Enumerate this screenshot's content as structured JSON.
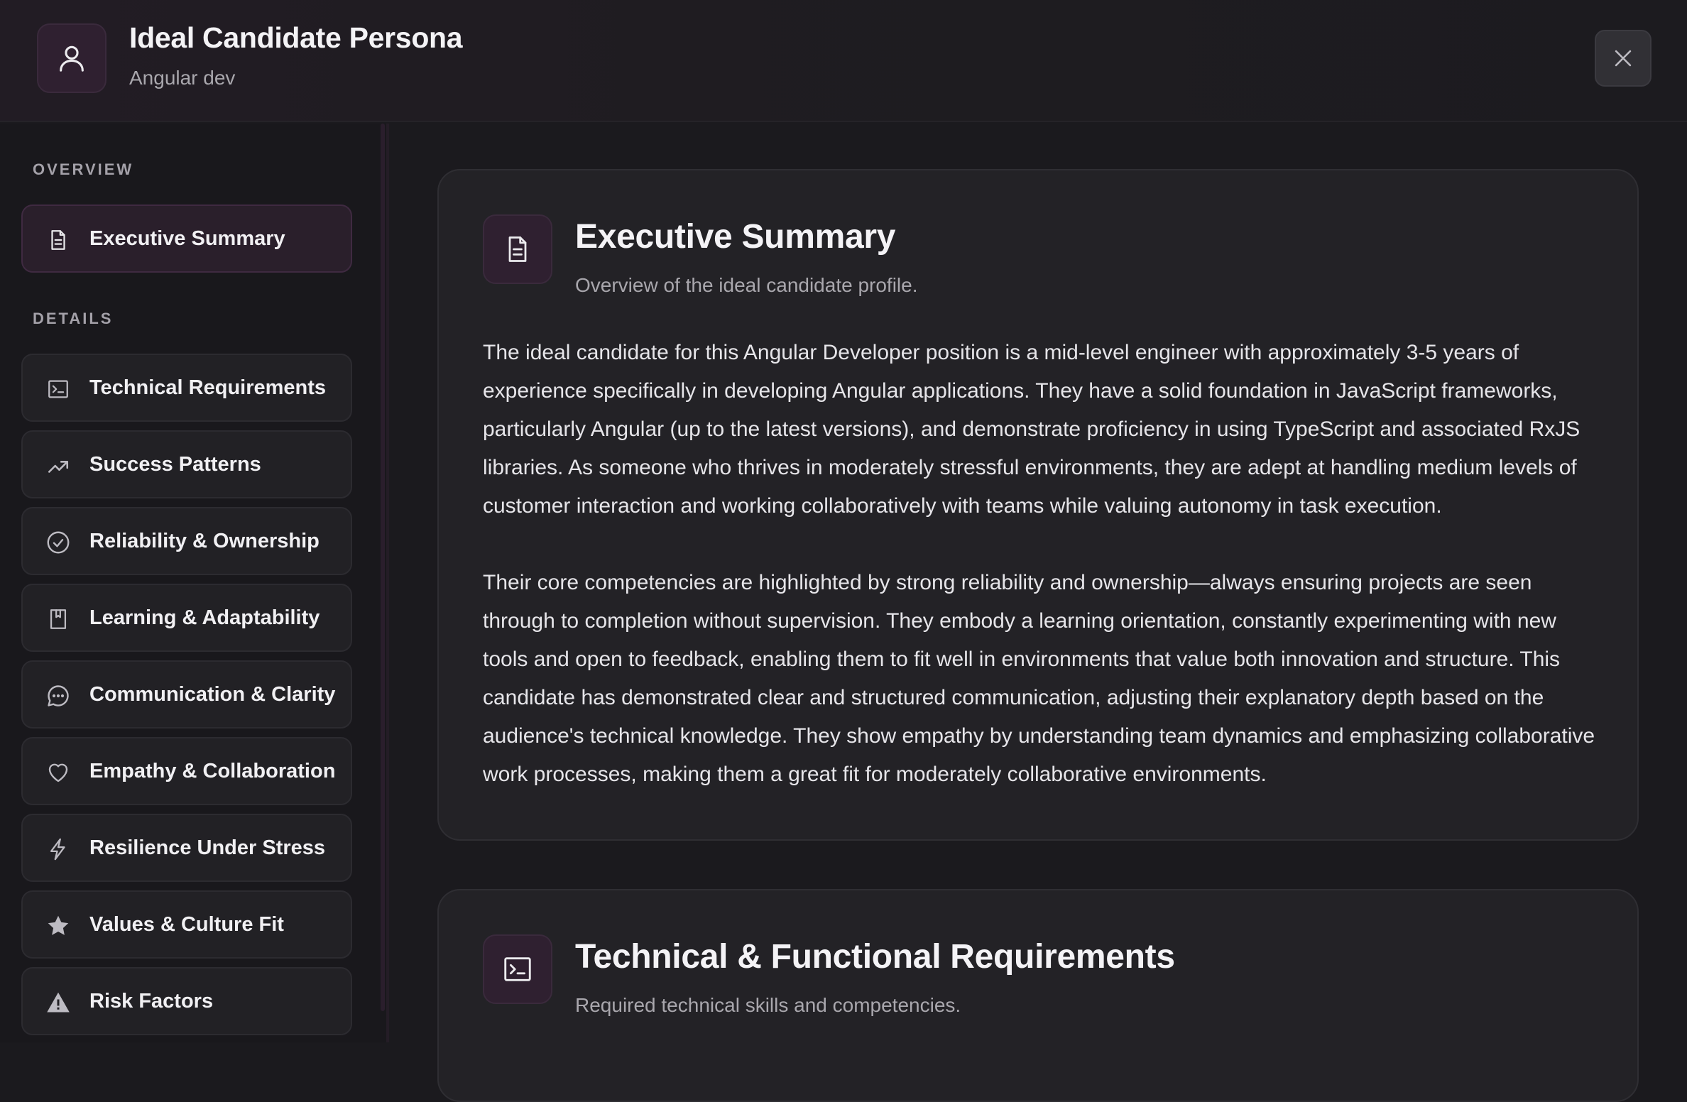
{
  "header": {
    "title": "Ideal Candidate Persona",
    "subtitle": "Angular dev",
    "avatar_icon": "user-icon",
    "close_icon": "close-icon"
  },
  "sidebar": {
    "sections": [
      {
        "label": "OVERVIEW",
        "items": [
          {
            "label": "Executive Summary",
            "icon": "document-icon",
            "active": true
          }
        ]
      },
      {
        "label": "DETAILS",
        "items": [
          {
            "label": "Technical Requirements",
            "icon": "terminal-icon"
          },
          {
            "label": "Success Patterns",
            "icon": "trending-up-icon"
          },
          {
            "label": "Reliability & Ownership",
            "icon": "check-circle-icon"
          },
          {
            "label": "Learning & Adaptability",
            "icon": "bookmark-icon"
          },
          {
            "label": "Communication & Clarity",
            "icon": "chat-icon"
          },
          {
            "label": "Empathy & Collaboration",
            "icon": "heart-icon"
          },
          {
            "label": "Resilience Under Stress",
            "icon": "lightning-icon"
          },
          {
            "label": "Values & Culture Fit",
            "icon": "star-icon"
          },
          {
            "label": "Risk Factors",
            "icon": "warning-icon"
          }
        ]
      }
    ]
  },
  "main": {
    "cards": [
      {
        "title": "Executive Summary",
        "subtitle": "Overview of the ideal candidate profile.",
        "icon": "document-icon",
        "paragraphs": [
          "The ideal candidate for this Angular Developer position is a mid-level engineer with approximately 3-5 years of experience specifically in developing Angular applications. They have a solid foundation in JavaScript frameworks, particularly Angular (up to the latest versions), and demonstrate proficiency in using TypeScript and associated RxJS libraries. As someone who thrives in moderately stressful environments, they are adept at handling medium levels of customer interaction and working collaboratively with teams while valuing autonomy in task execution.",
          "Their core competencies are highlighted by strong reliability and ownership—always ensuring projects are seen through to completion without supervision. They embody a learning orientation, constantly experimenting with new tools and open to feedback, enabling them to fit well in environments that value both innovation and structure. This candidate has demonstrated clear and structured communication, adjusting their explanatory depth based on the audience's technical knowledge. They show empathy by understanding team dynamics and emphasizing collaborative work processes, making them a great fit for moderately collaborative environments."
        ]
      },
      {
        "title": "Technical & Functional Requirements",
        "subtitle": "Required technical skills and competencies.",
        "icon": "terminal-icon"
      }
    ]
  },
  "colors": {
    "background": "#1b1a1e",
    "card": "#232226",
    "accent_purple": "#2f2030",
    "text_primary": "#f4f3f6",
    "text_secondary": "#a9a7ad"
  }
}
